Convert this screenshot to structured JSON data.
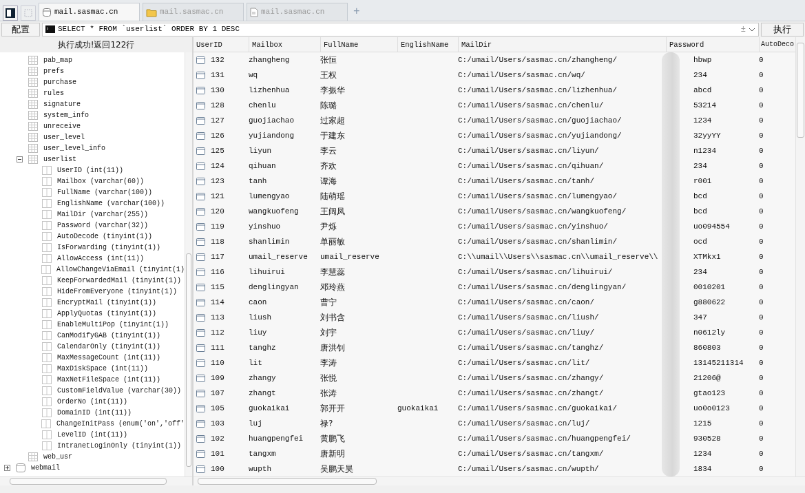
{
  "toolbar_buttons": [
    {
      "kind": "panel",
      "disabled": false
    },
    {
      "kind": "frame",
      "disabled": true
    }
  ],
  "tabs": [
    {
      "label": "mail.sasmac.cn",
      "kind": "database",
      "selected": true
    },
    {
      "label": "mail.sasmac.cn",
      "kind": "folder",
      "selected": false
    },
    {
      "label": "mail.sasmac.cn",
      "kind": "document",
      "selected": false
    }
  ],
  "new_tab": "+",
  "config_button": "配置",
  "query": {
    "value": "SELECT * FROM `userlist` ORDER BY 1 DESC",
    "history_toggle": "±"
  },
  "run_button": "执行",
  "status_message": "执行成功!返回122行",
  "tree": {
    "tables": [
      {
        "label": "pab_map"
      },
      {
        "label": "prefs"
      },
      {
        "label": "purchase"
      },
      {
        "label": "rules"
      },
      {
        "label": "signature"
      },
      {
        "label": "system_info"
      },
      {
        "label": "unreceive"
      },
      {
        "label": "user_level"
      },
      {
        "label": "user_level_info"
      },
      {
        "label": "userlist",
        "expanded": true,
        "children": [
          {
            "label": "UserID (int(11))"
          },
          {
            "label": "Mailbox (varchar(60))"
          },
          {
            "label": "FullName (varchar(100))"
          },
          {
            "label": "EnglishName (varchar(100))"
          },
          {
            "label": "MailDir (varchar(255))"
          },
          {
            "label": "Password (varchar(32))"
          },
          {
            "label": "AutoDecode (tinyint(1))"
          },
          {
            "label": "IsForwarding (tinyint(1))"
          },
          {
            "label": "AllowAccess (int(11))"
          },
          {
            "label": "AllowChangeViaEmail (tinyint(1)"
          },
          {
            "label": "KeepForwardedMail (tinyint(1))"
          },
          {
            "label": "HideFromEveryone (tinyint(1))"
          },
          {
            "label": "EncryptMail (tinyint(1))"
          },
          {
            "label": "ApplyQuotas (tinyint(1))"
          },
          {
            "label": "EnableMultiPop (tinyint(1))"
          },
          {
            "label": "CanModifyGAB (tinyint(1))"
          },
          {
            "label": "CalendarOnly (tinyint(1))"
          },
          {
            "label": "MaxMessageCount (int(11))"
          },
          {
            "label": "MaxDiskSpace (int(11))"
          },
          {
            "label": "MaxNetFileSpace (int(11))"
          },
          {
            "label": "CustomFieldValue (varchar(30))"
          },
          {
            "label": "OrderNo (int(11))"
          },
          {
            "label": "DomainID (int(11))"
          },
          {
            "label": "ChangeInitPass (enum('on','off'"
          },
          {
            "label": "LevelID (int(11))"
          },
          {
            "label": "IntranetLoginOnly (tinyint(1))"
          }
        ]
      },
      {
        "label": "web_usr"
      }
    ],
    "databases": [
      {
        "label": "webmail",
        "expanded": false
      }
    ]
  },
  "table": {
    "columns": [
      "UserID",
      "Mailbox",
      "FullName",
      "EnglishName",
      "MailDir",
      "Password",
      "AutoDeco"
    ],
    "rows": [
      [
        "132",
        "zhangheng",
        "张恒",
        "",
        "C:/umail/Users/sasmac.cn/zhangheng/",
        "hbwp",
        "0"
      ],
      [
        "131",
        "wq",
        "王权",
        "",
        "C:/umail/Users/sasmac.cn/wq/",
        "234",
        "0"
      ],
      [
        "130",
        "lizhenhua",
        "李振华",
        "",
        "C:/umail/Users/sasmac.cn/lizhenhua/",
        "abcd",
        "0"
      ],
      [
        "128",
        "chenlu",
        "陈璐",
        "",
        "C:/umail/Users/sasmac.cn/chenlu/",
        "53214",
        "0"
      ],
      [
        "127",
        "guojiachao",
        "过家超",
        "",
        "C:/umail/Users/sasmac.cn/guojiachao/",
        "1234",
        "0"
      ],
      [
        "126",
        "yujiandong",
        "于建东",
        "",
        "C:/umail/Users/sasmac.cn/yujiandong/",
        "32yyYY",
        "0"
      ],
      [
        "125",
        "liyun",
        "李云",
        "",
        "C:/umail/Users/sasmac.cn/liyun/",
        "n1234",
        "0"
      ],
      [
        "124",
        "qihuan",
        "齐欢",
        "",
        "C:/umail/Users/sasmac.cn/qihuan/",
        "234",
        "0"
      ],
      [
        "123",
        "tanh",
        "谭海",
        "",
        "C:/umail/Users/sasmac.cn/tanh/",
        "r001",
        "0"
      ],
      [
        "121",
        "lumengyao",
        "陆萌瑶",
        "",
        "C:/umail/Users/sasmac.cn/lumengyao/",
        "bcd",
        "0"
      ],
      [
        "120",
        "wangkuofeng",
        "王阔凤",
        "",
        "C:/umail/Users/sasmac.cn/wangkuofeng/",
        "bcd",
        "0"
      ],
      [
        "119",
        "yinshuo",
        "尹烁",
        "",
        "C:/umail/Users/sasmac.cn/yinshuo/",
        "uo094554",
        "0"
      ],
      [
        "118",
        "shanlimin",
        "单丽敏",
        "",
        "C:/umail/Users/sasmac.cn/shanlimin/",
        "ocd",
        "0"
      ],
      [
        "117",
        "umail_reserve",
        "umail_reserve",
        "",
        "C:\\\\umail\\\\Users\\\\sasmac.cn\\\\umail_reserve\\\\",
        "XTMkx1",
        "0"
      ],
      [
        "116",
        "lihuirui",
        "李慧蕊",
        "",
        "C:/umail/Users/sasmac.cn/lihuirui/",
        "234",
        "0"
      ],
      [
        "115",
        "denglingyan",
        "邓玲燕",
        "",
        "C:/umail/Users/sasmac.cn/denglingyan/",
        "0010201",
        "0"
      ],
      [
        "114",
        "caon",
        "曹宁",
        "",
        "C:/umail/Users/sasmac.cn/caon/",
        "g880622",
        "0"
      ],
      [
        "113",
        "liush",
        "刘书含",
        "",
        "C:/umail/Users/sasmac.cn/liush/",
        "347",
        "0"
      ],
      [
        "112",
        "liuy",
        "刘宇",
        "",
        "C:/umail/Users/sasmac.cn/liuy/",
        "n0612ly",
        "0"
      ],
      [
        "111",
        "tanghz",
        "唐洪钊",
        "",
        "C:/umail/Users/sasmac.cn/tanghz/",
        "860803",
        "0"
      ],
      [
        "110",
        "lit",
        "李涛",
        "",
        "C:/umail/Users/sasmac.cn/lit/",
        "13145211314",
        "0"
      ],
      [
        "109",
        "zhangy",
        "张悦",
        "",
        "C:/umail/Users/sasmac.cn/zhangy/",
        "21206@",
        "0"
      ],
      [
        "107",
        "zhangt",
        "张涛",
        "",
        "C:/umail/Users/sasmac.cn/zhangt/",
        "gtao123",
        "0"
      ],
      [
        "105",
        "guokaikai",
        "郭开开",
        "guokaikai",
        "C:/umail/Users/sasmac.cn/guokaikai/",
        "uo0o0123",
        "0"
      ],
      [
        "103",
        "luj",
        "禄?",
        "",
        "C:/umail/Users/sasmac.cn/luj/",
        "1215",
        "0"
      ],
      [
        "102",
        "huangpengfei",
        "黄鹏飞",
        "",
        "C:/umail/Users/sasmac.cn/huangpengfei/",
        "930528",
        "0"
      ],
      [
        "101",
        "tangxm",
        "唐新明",
        "",
        "C:/umail/Users/sasmac.cn/tangxm/",
        "1234",
        "0"
      ],
      [
        "100",
        "wupth",
        "吴鹏天昊",
        "",
        "C:/umail/Users/sasmac.cn/wupth/",
        "1834",
        "0"
      ]
    ]
  }
}
